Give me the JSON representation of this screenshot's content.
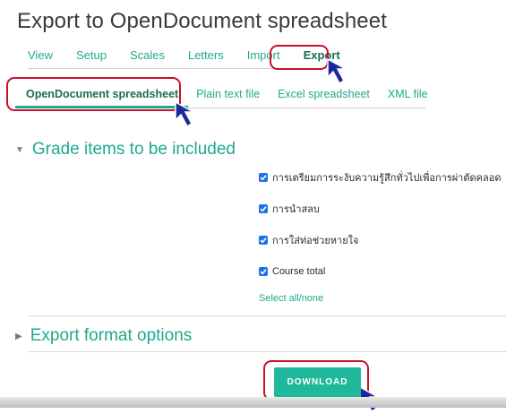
{
  "page_title": "Export to OpenDocument spreadsheet",
  "primary_tabs": [
    "View",
    "Setup",
    "Scales",
    "Letters",
    "Import",
    "Export"
  ],
  "secondary_tabs": [
    "OpenDocument spreadsheet",
    "Plain text file",
    "Excel spreadsheet",
    "XML file"
  ],
  "grade_section": {
    "title": "Grade items to be included",
    "items": [
      "การเตรียมการระงับความรู้สึกทั่วไปเพื่อการผ่าตัดคลอด",
      "การนำสลบ",
      "การใส่ท่อช่วยหายใจ",
      "Course total"
    ],
    "select_all": "Select all/none"
  },
  "format_section": {
    "title": "Export format options"
  },
  "download_label": "DOWNLOAD",
  "colors": {
    "accent": "#1fa98e",
    "highlight": "#c8102e",
    "cursor": "#1a2a9c",
    "checkbox": "#1a73e8"
  }
}
